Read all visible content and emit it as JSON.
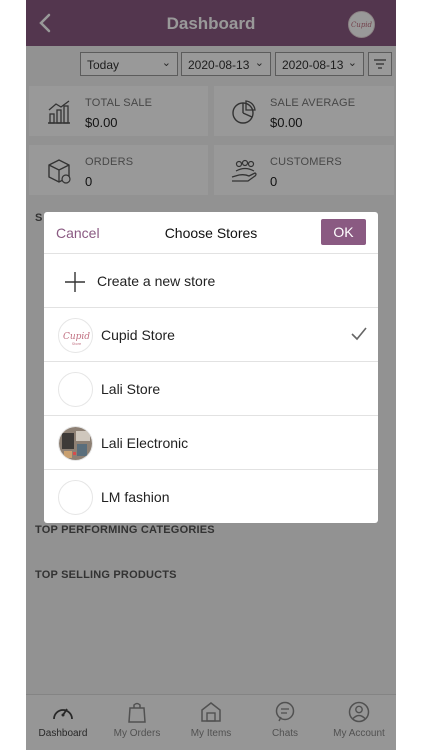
{
  "header": {
    "title": "Dashboard",
    "avatar_text": "Cupid"
  },
  "filters": {
    "range": "Today",
    "date_from": "2020-08-13",
    "date_to": "2020-08-13"
  },
  "stats": [
    {
      "label": "TOTAL SALE",
      "value": "$0.00",
      "icon": "bar-chart-icon"
    },
    {
      "label": "SALE AVERAGE",
      "value": "$0.00",
      "icon": "pie-chart-icon"
    },
    {
      "label": "ORDERS",
      "value": "0",
      "icon": "box-icon"
    },
    {
      "label": "CUSTOMERS",
      "value": "0",
      "icon": "customers-hand-icon"
    }
  ],
  "sections": {
    "categories": "TOP PERFORMING CATEGORIES",
    "products": "TOP SELLING PRODUCTS",
    "partial_left": "S"
  },
  "modal": {
    "cancel": "Cancel",
    "title": "Choose Stores",
    "ok": "OK",
    "create": "Create a new store",
    "stores": [
      {
        "name": "Cupid Store",
        "selected": true,
        "logo": "cupid-logo"
      },
      {
        "name": "Lali Store",
        "selected": false,
        "logo": "blank"
      },
      {
        "name": "Lali Electronic",
        "selected": false,
        "logo": "photo"
      },
      {
        "name": "LM fashion",
        "selected": false,
        "logo": "blank"
      }
    ]
  },
  "nav": [
    {
      "label": "Dashboard",
      "icon": "gauge-icon",
      "active": true
    },
    {
      "label": "My Orders",
      "icon": "bag-icon",
      "active": false
    },
    {
      "label": "My Items",
      "icon": "store-icon",
      "active": false
    },
    {
      "label": "Chats",
      "icon": "chat-bubble-icon",
      "active": false
    },
    {
      "label": "My Account",
      "icon": "user-icon",
      "active": false
    }
  ],
  "colors": {
    "brand": "#8a5a82",
    "overlay": "rgba(0,0,0,0.4)"
  }
}
